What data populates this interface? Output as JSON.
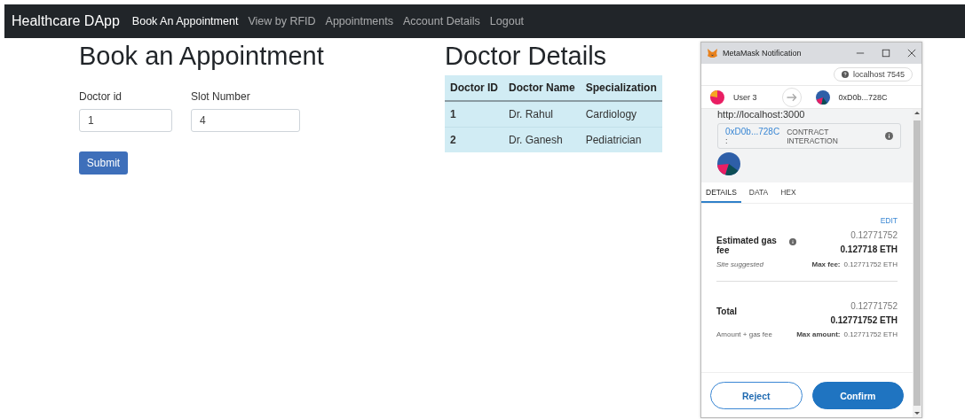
{
  "navbar": {
    "brand": "Healthcare DApp",
    "links": [
      {
        "label": "Book An Appointment",
        "selected": true
      },
      {
        "label": "View by RFID",
        "selected": false
      },
      {
        "label": "Appointments",
        "selected": false
      },
      {
        "label": "Account Details",
        "selected": false
      },
      {
        "label": "Logout",
        "selected": false
      }
    ]
  },
  "booking": {
    "title": "Book an Appointment",
    "fields": [
      {
        "label": "Doctor id",
        "value": "1"
      },
      {
        "label": "Slot Number",
        "value": "4"
      }
    ],
    "submit": "Submit"
  },
  "doctors": {
    "title": "Doctor Details",
    "columns": [
      "Doctor ID",
      "Doctor Name",
      "Specialization"
    ],
    "rows": [
      [
        "1",
        "Dr. Rahul",
        "Cardiology"
      ],
      [
        "2",
        "Dr. Ganesh",
        "Pediatrician"
      ]
    ]
  },
  "metamask": {
    "title": "MetaMask Notification",
    "network": "localhost 7545",
    "from_account": "User 3",
    "to_account": "0xD0b...728C",
    "origin": "http://localhost:3000",
    "contract_address": "0xD0b...728C",
    "contract_separator": ":",
    "contract_type": "CONTRACT INTERACTION",
    "tabs": [
      {
        "label": "DETAILS",
        "selected": true
      },
      {
        "label": "DATA",
        "selected": false
      },
      {
        "label": "HEX",
        "selected": false
      }
    ],
    "edit": "EDIT",
    "fees": [
      {
        "label": "Estimated gas fee",
        "info": true,
        "amount": "0.12771752",
        "amount_bold": "0.127718 ETH",
        "note": "Site suggested",
        "note_italic": true,
        "max_label": "Max fee:",
        "max_value": "0.12771752 ETH"
      },
      {
        "label": "Total",
        "info": false,
        "amount": "0.12771752",
        "amount_bold": "0.12771752 ETH",
        "note": "Amount + gas fee",
        "note_italic": false,
        "max_label": "Max amount:",
        "max_value": "0.12771752 ETH"
      }
    ],
    "reject": "Reject",
    "confirm": "Confirm"
  }
}
